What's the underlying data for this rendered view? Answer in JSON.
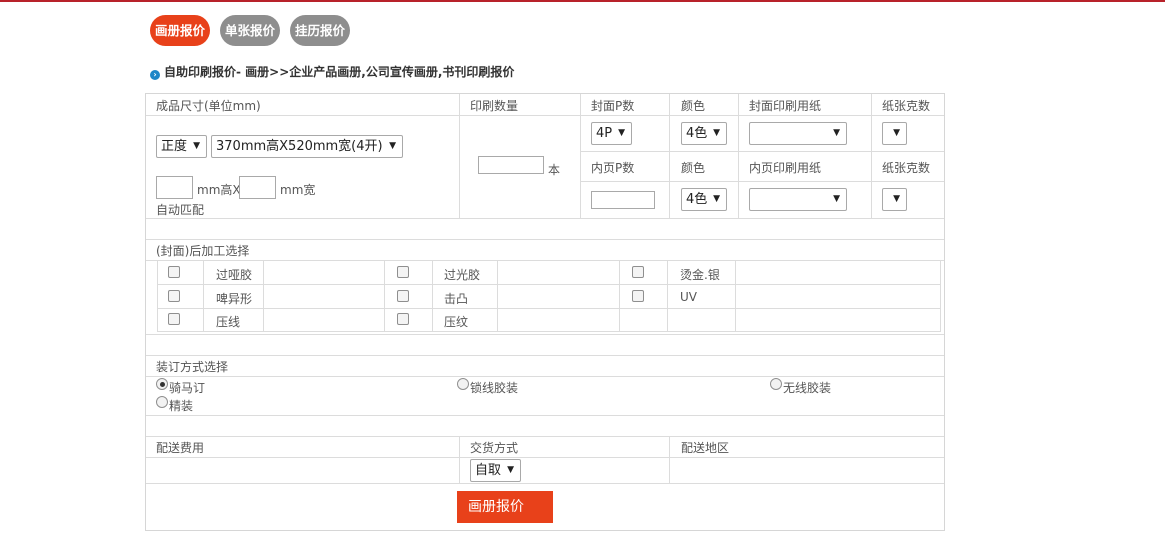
{
  "tabs": [
    {
      "label": "画册报价"
    },
    {
      "label": "单张报价"
    },
    {
      "label": "挂历报价"
    }
  ],
  "breadcrumb": "自助印刷报价- 画册>>企业产品画册,公司宣传画册,书刊印刷报价",
  "headers": {
    "size": "成品尺寸(单位mm)",
    "quantity": "印刷数量",
    "cover_p": "封面P数",
    "color": "颜色",
    "cover_paper": "封面印刷用纸",
    "paper_weight": "纸张克数",
    "inner_p": "内页P数",
    "inner_paper": "内页印刷用纸"
  },
  "size": {
    "format_value": "正度",
    "preset_value": "370mm高X520mm宽(4开)",
    "height_unit": "mm高X",
    "width_unit": "mm宽",
    "auto_match": "自动匹配"
  },
  "quantity": {
    "unit": "本"
  },
  "cover": {
    "p_value": "4P",
    "color_value": "4色",
    "paper_value": "",
    "weight_value": ""
  },
  "inner": {
    "color_value": "4色",
    "paper_value": "",
    "weight_value": ""
  },
  "finishing": {
    "title": "(封面)后加工选择",
    "rows": [
      [
        "过哑胶",
        "过光胶",
        "烫金.银"
      ],
      [
        "啤异形",
        "击凸",
        "UV"
      ],
      [
        "压线",
        "压纹"
      ]
    ]
  },
  "binding": {
    "title": "装订方式选择",
    "options": [
      "骑马订",
      "锁线胶装",
      "无线胶装",
      "精装"
    ],
    "selected": "骑马订"
  },
  "delivery": {
    "fee_label": "配送费用",
    "method_label": "交货方式",
    "region_label": "配送地区",
    "method_value": "自取"
  },
  "submit_label": "画册报价",
  "colors": {
    "accent": "#e8411a",
    "inactive_tab": "#8e8e8e",
    "topline": "#b8222a"
  }
}
